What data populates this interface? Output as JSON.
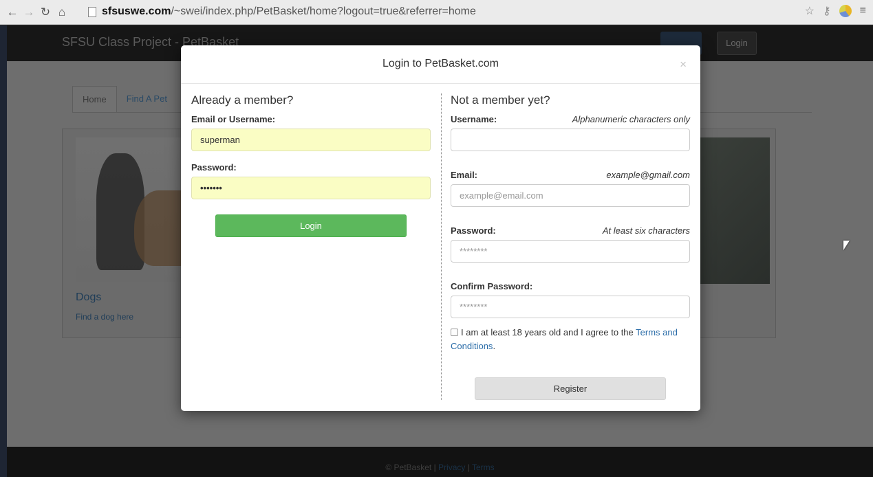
{
  "browser": {
    "url_domain": "sfsuswe.com",
    "url_path": "/~swei/index.php/PetBasket/home?logout=true&referrer=home"
  },
  "site": {
    "brand": "SFSU Class Project - PetBasket",
    "login_label": "Login",
    "tabs": [
      {
        "label": "Home"
      },
      {
        "label": "Find A Pet"
      }
    ],
    "card": {
      "title": "Dogs",
      "link": "Find a dog here"
    },
    "footer": {
      "copyright": "© PetBasket",
      "separator": "|",
      "privacy": "Privacy",
      "terms": "Terms"
    }
  },
  "modal": {
    "title": "Login to PetBasket.com",
    "close_glyph": "×",
    "login": {
      "heading": "Already a member?",
      "username_label": "Email or Username:",
      "username_value": "superman",
      "password_label": "Password:",
      "password_value": "•••••••",
      "button": "Login"
    },
    "register": {
      "heading": "Not a member yet?",
      "username_label": "Username:",
      "username_hint": "Alphanumeric characters only",
      "email_label": "Email:",
      "email_hint": "example@gmail.com",
      "email_placeholder": "example@email.com",
      "password_label": "Password:",
      "password_hint": "At least six characters",
      "password_placeholder": "********",
      "confirm_label": "Confirm Password:",
      "confirm_placeholder": "********",
      "agree_text": "I am at least 18 years old and I agree to the",
      "terms_link": "Terms and Conditions",
      "agree_end": ".",
      "button": "Register"
    }
  },
  "colors": {
    "login_button": "#5cb85c",
    "autofill": "#fafdc4",
    "link": "#2a6ca8"
  }
}
